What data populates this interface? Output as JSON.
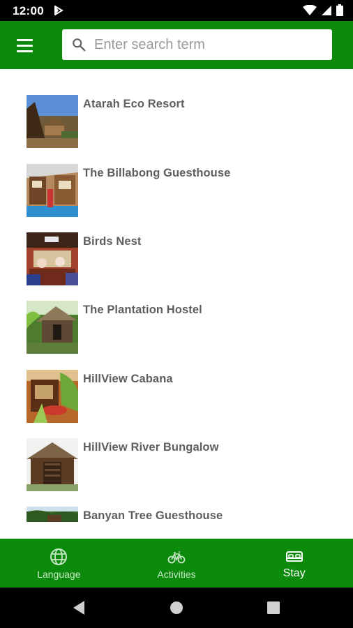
{
  "status_bar": {
    "time": "12:00"
  },
  "app_bar": {
    "search_placeholder": "Enter search term",
    "search_value": ""
  },
  "items": [
    {
      "title": "Atarah Eco Resort"
    },
    {
      "title": "The Billabong Guesthouse"
    },
    {
      "title": "Birds Nest"
    },
    {
      "title": "The Plantation Hostel"
    },
    {
      "title": "HillView Cabana"
    },
    {
      "title": "HillView River Bungalow"
    },
    {
      "title": "Banyan Tree Guesthouse"
    }
  ],
  "bottom_nav": [
    {
      "label": "Language",
      "icon": "globe-icon",
      "active": false
    },
    {
      "label": "Activities",
      "icon": "bicycle-icon",
      "active": false
    },
    {
      "label": "Stay",
      "icon": "bed-icon",
      "active": true
    }
  ],
  "colors": {
    "primary": "#0b8a0b",
    "title_text": "#5e5e5e",
    "nav_inactive": "#c7e6c7",
    "nav_active": "#ffffff"
  }
}
